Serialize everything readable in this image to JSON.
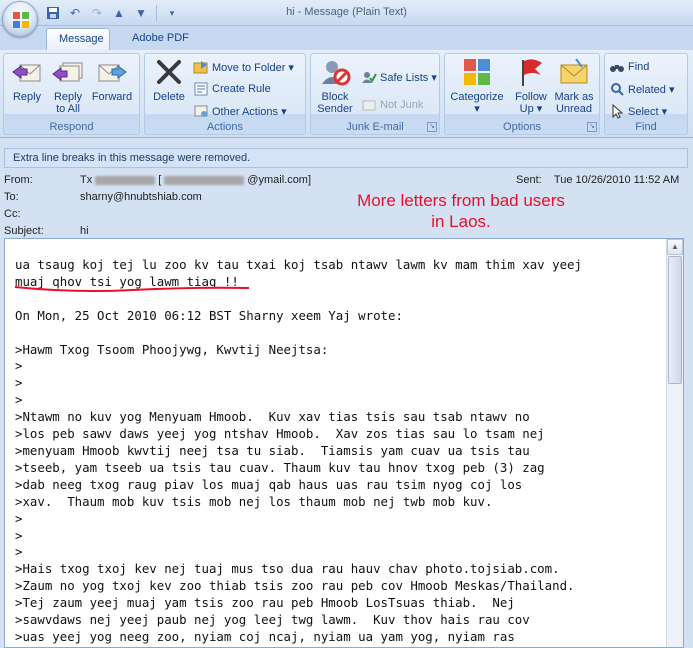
{
  "window": {
    "title": "hi - Message (Plain Text)"
  },
  "tabs": [
    {
      "label": "Message",
      "active": true
    },
    {
      "label": "Adobe PDF",
      "active": false
    }
  ],
  "ribbon": {
    "respond": {
      "label": "Respond",
      "reply": "Reply",
      "reply_all_1": "Reply",
      "reply_all_2": "to All",
      "forward": "Forward"
    },
    "actions": {
      "label": "Actions",
      "delete": "Delete",
      "move_to_folder": "Move to Folder ▾",
      "create_rule": "Create Rule",
      "other_actions": "Other Actions ▾"
    },
    "junk": {
      "label": "Junk E-mail",
      "block_sender_1": "Block",
      "block_sender_2": "Sender",
      "safe_lists": "Safe Lists ▾",
      "not_junk": "Not Junk"
    },
    "options": {
      "label": "Options",
      "categorize_1": "Categorize",
      "categorize_2": "▾",
      "follow_up_1": "Follow",
      "follow_up_2": "Up ▾",
      "mark_unread_1": "Mark as",
      "mark_unread_2": "Unread"
    },
    "find": {
      "label": "Find",
      "find": "Find",
      "related": "Related ▾",
      "select": "Select ▾"
    }
  },
  "infobar": {
    "text": "Extra line breaks in this message were removed."
  },
  "header": {
    "from_label": "From:",
    "from_prefix": "Tx",
    "from_open": "[",
    "from_suffix": "@ymail.com]",
    "to_label": "To:",
    "to_value": "sharny@hnubtshiab.com",
    "cc_label": "Cc:",
    "subject_label": "Subject:",
    "subject_value": "hi",
    "sent_label": "Sent:",
    "sent_value": "Tue 10/26/2010 11:52 AM"
  },
  "annotation": {
    "line1": "More letters from bad users",
    "line2": "in Laos."
  },
  "body": {
    "text": "ua tsaug koj tej lu zoo kv tau txai koj tsab ntawv lawm kv mam thim xav yeej\nmuaj qhov tsi yog lawm tiag !!\n\nOn Mon, 25 Oct 2010 06:12 BST Sharny xeem Yaj wrote:\n\n>Hawm Txog Tsoom Phoojywg, Kwvtij Neejtsa:\n>\n>\n>\n>Ntawm no kuv yog Menyuam Hmoob.  Kuv xav tias tsis sau tsab ntawv no\n>los peb sawv daws yeej yog ntshav Hmoob.  Xav zos tias sau lo tsam nej\n>menyuam Hmoob kwvtij neej tsa tu siab.  Tiamsis yam cuav ua tsis tau\n>tseeb, yam tseeb ua tsis tau cuav. Thaum kuv tau hnov txog peb (3) zag\n>dab neeg txog raug piav los muaj qab haus uas rau tsim nyog coj los\n>xav.  Thaum mob kuv tsis mob nej los thaum mob nej twb mob kuv.\n>\n>\n>\n>Hais txog txoj kev nej tuaj mus tso dua rau hauv chav photo.tojsiab.com.\n>Zaum no yog txoj kev zoo thiab tsis zoo rau peb cov Hmoob Meskas/Thailand.\n>Tej zaum yeej muaj yam tsis zoo rau peb Hmoob LosTsuas thiab.  Nej\n>sawvdaws nej yeej paub nej yog leej twg lawm.  Kuv thov hais rau cov\n>uas yeej yog neeg zoo, nyiam coj ncaj, nyiam ua yam yog, nyiam ras"
  },
  "colors": {
    "annotation": "#e8102a",
    "ribbon_text": "#15428b"
  }
}
